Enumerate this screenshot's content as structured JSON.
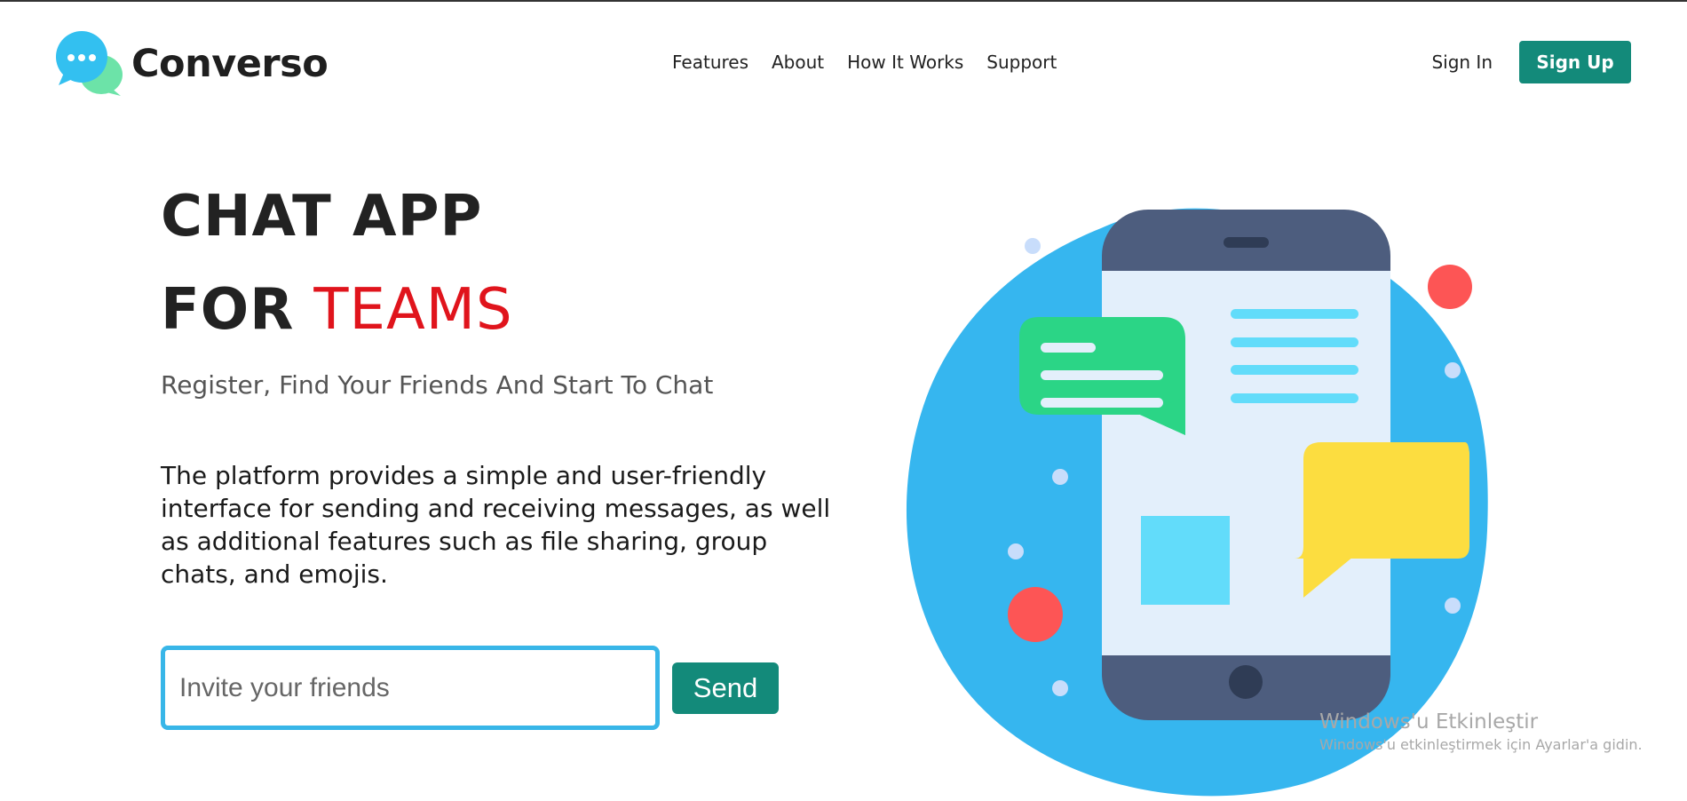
{
  "brand": {
    "name": "Converso",
    "logo_icon": "chat-bubbles-logo-icon"
  },
  "nav": {
    "items": [
      {
        "label": "Features"
      },
      {
        "label": "About"
      },
      {
        "label": "How It Works"
      },
      {
        "label": "Support"
      }
    ]
  },
  "auth": {
    "signin_label": "Sign In",
    "signup_label": "Sign Up"
  },
  "hero": {
    "title_line1": "CHAT APP",
    "title_line2_prefix": "FOR",
    "title_line2_accent": "TEAMS",
    "subtitle": "Register, Find Your Friends And Start To Chat",
    "description": "The platform provides a simple and user-friendly interface for sending and receiving messages, as well as additional features such as file sharing, group chats, and emojis."
  },
  "invite": {
    "placeholder": "Invite your friends",
    "value": "",
    "send_label": "Send"
  },
  "illustration": {
    "icon": "phone-chat-illustration"
  },
  "watermark": {
    "title": "Windows'u Etkinleştir",
    "subtitle": "Windows'u etkinleştirmek için Ayarlar'a gidin."
  },
  "colors": {
    "accent_teal": "#138a7a",
    "accent_red": "#e0141c",
    "input_border": "#38b6e8",
    "blob_blue": "#36b6ef",
    "phone_dark": "#4d5d7e",
    "screen_light": "#e3effb",
    "bubble_green": "#2bd586",
    "bubble_yellow": "#fcdd40",
    "dot_red": "#fd5555"
  }
}
